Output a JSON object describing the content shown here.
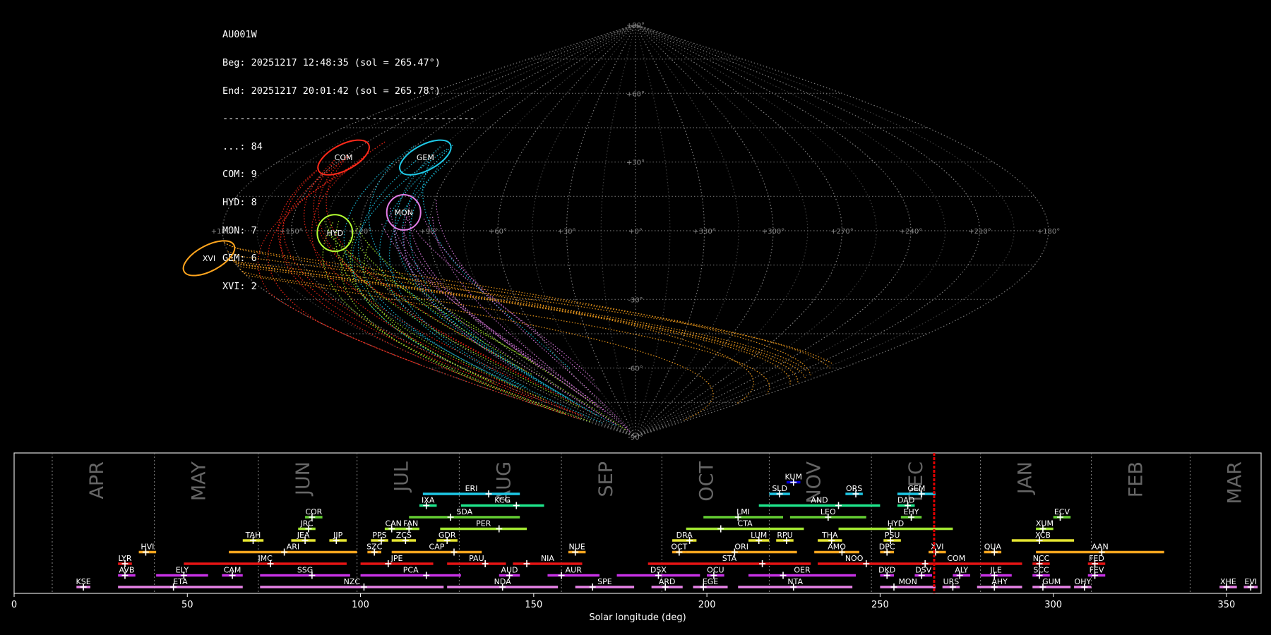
{
  "header": {
    "station": "AU001W",
    "begin": "Beg: 20251217 12:48:35 (sol = 265.47°)",
    "end": "End: 20251217 20:01:42 (sol = 265.78°)",
    "separator": "--------------------------------------------",
    "counts": [
      {
        "code": "...",
        "count": 84
      },
      {
        "code": "COM",
        "count": 9
      },
      {
        "code": "HYD",
        "count": 8
      },
      {
        "code": "MON",
        "count": 7
      },
      {
        "code": "GEM",
        "count": 6
      },
      {
        "code": "XVI",
        "count": 2
      }
    ]
  },
  "chart_data": [
    {
      "type": "scatter",
      "projection": "sinusoidal",
      "grid": true,
      "lon_tick_labels": [
        "+180°",
        "+150°",
        "+120°",
        "+90°",
        "+60°",
        "+30°",
        "+0°",
        "+330°",
        "+300°",
        "+270°",
        "+240°",
        "+210°",
        "+180°"
      ],
      "lat_tick_labels": [
        "+90°",
        "+60°",
        "+30°",
        "-30°",
        "-60°",
        "-90°"
      ],
      "radiants": [
        {
          "name": "COM",
          "lon": 150,
          "lat": 32,
          "color": "#ff2a1a"
        },
        {
          "name": "GEM",
          "lon": 108,
          "lat": 32,
          "color": "#1ec8e6"
        },
        {
          "name": "HYD",
          "lon": 131,
          "lat": -1,
          "color": "#b4ff32"
        },
        {
          "name": "MON",
          "lon": 102,
          "lat": 8,
          "color": "#e27de6"
        },
        {
          "name": "XVI",
          "lon": 190,
          "lat": -12,
          "color": "#ffa51e"
        }
      ]
    },
    {
      "type": "timeline",
      "xlabel": "Solar longitude (deg)",
      "xlim": [
        0,
        360
      ],
      "x_ticks": [
        0,
        50,
        100,
        150,
        200,
        250,
        300,
        350
      ],
      "current_solar_longitude": 265.6,
      "months": [
        {
          "label": "APR",
          "start": 11
        },
        {
          "label": "MAY",
          "start": 40.5
        },
        {
          "label": "JUN",
          "start": 70.5
        },
        {
          "label": "JUL",
          "start": 99
        },
        {
          "label": "AUG",
          "start": 128.5
        },
        {
          "label": "SEP",
          "start": 158
        },
        {
          "label": "OCT",
          "start": 187
        },
        {
          "label": "NOV",
          "start": 218
        },
        {
          "label": "DEC",
          "start": 247.5
        },
        {
          "label": "JAN",
          "start": 279
        },
        {
          "label": "FEB",
          "start": 311
        },
        {
          "label": "MAR",
          "start": 339.5
        }
      ],
      "showers": [
        {
          "code": "KUM",
          "start": 223,
          "end": 227,
          "peak": 225,
          "row": 8,
          "color": "#0000dd"
        },
        {
          "code": "ERI",
          "start": 118,
          "end": 146,
          "peak": 137,
          "row": 7,
          "color": "#1ec8e6"
        },
        {
          "code": "SLD",
          "start": 218,
          "end": 224,
          "peak": 221,
          "row": 7,
          "color": "#1ec8e6"
        },
        {
          "code": "ORS",
          "start": 240,
          "end": 245,
          "peak": 243,
          "row": 7,
          "color": "#1ec8e6"
        },
        {
          "code": "GEM",
          "start": 255,
          "end": 266,
          "peak": 262,
          "row": 7,
          "color": "#1ec8e6"
        },
        {
          "code": "IXA",
          "start": 117,
          "end": 122,
          "peak": 119,
          "row": 6,
          "color": "#1ee68c"
        },
        {
          "code": "KCG",
          "start": 129,
          "end": 153,
          "peak": 145,
          "row": 6,
          "color": "#1ee68c"
        },
        {
          "code": "AND",
          "start": 215,
          "end": 250,
          "peak": 238,
          "row": 6,
          "color": "#1ee68c"
        },
        {
          "code": "DAD",
          "start": 255,
          "end": 260,
          "peak": 258,
          "row": 6,
          "color": "#1ee68c"
        },
        {
          "code": "COR",
          "start": 84,
          "end": 89,
          "peak": 86,
          "row": 5,
          "color": "#64cd32"
        },
        {
          "code": "SDA",
          "start": 114,
          "end": 146,
          "peak": 126,
          "row": 5,
          "color": "#64cd32"
        },
        {
          "code": "LMI",
          "start": 199,
          "end": 222,
          "peak": 209,
          "row": 5,
          "color": "#64cd32"
        },
        {
          "code": "LEO",
          "start": 224,
          "end": 246,
          "peak": 235,
          "row": 5,
          "color": "#64cd32"
        },
        {
          "code": "EHY",
          "start": 256,
          "end": 262,
          "peak": 259,
          "row": 5,
          "color": "#64cd32"
        },
        {
          "code": "ECV",
          "start": 300,
          "end": 305,
          "peak": 302,
          "row": 5,
          "color": "#64cd32"
        },
        {
          "code": "JRC",
          "start": 82,
          "end": 87,
          "peak": 85,
          "row": 4,
          "color": "#a0e632"
        },
        {
          "code": "CAN",
          "start": 107,
          "end": 112,
          "peak": 109,
          "row": 4,
          "color": "#a0e632"
        },
        {
          "code": "FAN",
          "start": 112,
          "end": 117,
          "peak": 114,
          "row": 4,
          "color": "#a0e632"
        },
        {
          "code": "PER",
          "start": 123,
          "end": 148,
          "peak": 140,
          "row": 4,
          "color": "#a0e632"
        },
        {
          "code": "CTA",
          "start": 194,
          "end": 228,
          "peak": 204,
          "row": 4,
          "color": "#a0e632"
        },
        {
          "code": "HYD",
          "start": 238,
          "end": 271,
          "peak": 253,
          "row": 4,
          "color": "#a0e632"
        },
        {
          "code": "XUM",
          "start": 295,
          "end": 300,
          "peak": 297,
          "row": 4,
          "color": "#a0e632"
        },
        {
          "code": "TAH",
          "start": 66,
          "end": 72,
          "peak": 69,
          "row": 3,
          "color": "#e6e632"
        },
        {
          "code": "JEA",
          "start": 80,
          "end": 87,
          "peak": 84,
          "row": 3,
          "color": "#e6e632"
        },
        {
          "code": "JIP",
          "start": 91,
          "end": 96,
          "peak": 93,
          "row": 3,
          "color": "#e6e632"
        },
        {
          "code": "PPS",
          "start": 103,
          "end": 108,
          "peak": 106,
          "row": 3,
          "color": "#e6e632"
        },
        {
          "code": "ZCS",
          "start": 109,
          "end": 116,
          "peak": 113,
          "row": 3,
          "color": "#e6e632"
        },
        {
          "code": "GDR",
          "start": 122,
          "end": 128,
          "peak": 125,
          "row": 3,
          "color": "#e6e632"
        },
        {
          "code": "DRA",
          "start": 190,
          "end": 197,
          "peak": 195,
          "row": 3,
          "color": "#e6e632"
        },
        {
          "code": "LUM",
          "start": 212,
          "end": 218,
          "peak": 215,
          "row": 3,
          "color": "#e6e632"
        },
        {
          "code": "RPU",
          "start": 220,
          "end": 225,
          "peak": 223,
          "row": 3,
          "color": "#e6e632"
        },
        {
          "code": "THA",
          "start": 232,
          "end": 239,
          "peak": 236,
          "row": 3,
          "color": "#e6e632"
        },
        {
          "code": "PSU",
          "start": 251,
          "end": 256,
          "peak": 253,
          "row": 3,
          "color": "#e6e632"
        },
        {
          "code": "XCB",
          "start": 288,
          "end": 306,
          "peak": 296,
          "row": 3,
          "color": "#e6e632"
        },
        {
          "code": "HVI",
          "start": 36,
          "end": 41,
          "peak": 38,
          "row": 2,
          "color": "#ffa51e"
        },
        {
          "code": "ARI",
          "start": 62,
          "end": 99,
          "peak": 78,
          "row": 2,
          "color": "#ffa51e"
        },
        {
          "code": "SZC",
          "start": 102,
          "end": 106,
          "peak": 104,
          "row": 2,
          "color": "#ffa51e"
        },
        {
          "code": "CAP",
          "start": 109,
          "end": 135,
          "peak": 127,
          "row": 2,
          "color": "#ffa51e"
        },
        {
          "code": "NUE",
          "start": 160,
          "end": 165,
          "peak": 162,
          "row": 2,
          "color": "#ffa51e"
        },
        {
          "code": "OCT",
          "start": 190,
          "end": 194,
          "peak": 192,
          "row": 2,
          "color": "#ffa51e"
        },
        {
          "code": "ORI",
          "start": 194,
          "end": 226,
          "peak": 208,
          "row": 2,
          "color": "#ffa51e"
        },
        {
          "code": "AMO",
          "start": 231,
          "end": 244,
          "peak": 239,
          "row": 2,
          "color": "#ffa51e"
        },
        {
          "code": "DPC",
          "start": 250,
          "end": 254,
          "peak": 252,
          "row": 2,
          "color": "#ffa51e"
        },
        {
          "code": "XVI",
          "start": 264,
          "end": 269,
          "peak": 266,
          "row": 2,
          "color": "#ffa51e"
        },
        {
          "code": "QUA",
          "start": 280,
          "end": 285,
          "peak": 283,
          "row": 2,
          "color": "#ffa51e"
        },
        {
          "code": "AAN",
          "start": 295,
          "end": 332,
          "peak": 314,
          "row": 2,
          "color": "#ffa51e"
        },
        {
          "code": "LYR",
          "start": 30,
          "end": 34,
          "peak": 32,
          "row": 1,
          "color": "#e61414"
        },
        {
          "code": "JMC",
          "start": 49,
          "end": 96,
          "peak": 74,
          "row": 1,
          "color": "#e61414"
        },
        {
          "code": "JPE",
          "start": 100,
          "end": 121,
          "peak": 108,
          "row": 1,
          "color": "#e61414"
        },
        {
          "code": "PAU",
          "start": 125,
          "end": 142,
          "peak": 136,
          "row": 1,
          "color": "#e61414"
        },
        {
          "code": "NIA",
          "start": 144,
          "end": 164,
          "peak": 148,
          "row": 1,
          "color": "#e61414"
        },
        {
          "code": "STA",
          "start": 183,
          "end": 230,
          "peak": 216,
          "row": 1,
          "color": "#e61414"
        },
        {
          "code": "NOO",
          "start": 232,
          "end": 253,
          "peak": 246,
          "row": 1,
          "color": "#e61414"
        },
        {
          "code": "COM",
          "start": 253,
          "end": 291,
          "peak": 263,
          "row": 1,
          "color": "#e61414"
        },
        {
          "code": "NCC",
          "start": 294,
          "end": 299,
          "peak": 296,
          "row": 1,
          "color": "#e61414"
        },
        {
          "code": "FED",
          "start": 310,
          "end": 315,
          "peak": 312,
          "row": 1,
          "color": "#e61414"
        },
        {
          "code": "AVB",
          "start": 30,
          "end": 35,
          "peak": 32,
          "row": 0,
          "color": "#c832e6"
        },
        {
          "code": "ELY",
          "start": 41,
          "end": 56,
          "peak": 49,
          "row": 0,
          "color": "#c832e6"
        },
        {
          "code": "CAM",
          "start": 60,
          "end": 66,
          "peak": 63,
          "row": 0,
          "color": "#c832e6"
        },
        {
          "code": "SSG",
          "start": 71,
          "end": 97,
          "peak": 86,
          "row": 0,
          "color": "#c832e6"
        },
        {
          "code": "PCA",
          "start": 100,
          "end": 129,
          "peak": 119,
          "row": 0,
          "color": "#c832e6"
        },
        {
          "code": "AUD",
          "start": 140,
          "end": 146,
          "peak": 143,
          "row": 0,
          "color": "#c832e6"
        },
        {
          "code": "AUR",
          "start": 154,
          "end": 169,
          "peak": 158,
          "row": 0,
          "color": "#c832e6"
        },
        {
          "code": "DSX",
          "start": 174,
          "end": 198,
          "peak": 186,
          "row": 0,
          "color": "#c832e6"
        },
        {
          "code": "OCU",
          "start": 200,
          "end": 205,
          "peak": 202,
          "row": 0,
          "color": "#c832e6"
        },
        {
          "code": "OER",
          "start": 212,
          "end": 243,
          "peak": 222,
          "row": 0,
          "color": "#c832e6"
        },
        {
          "code": "DKD",
          "start": 250,
          "end": 254,
          "peak": 252,
          "row": 0,
          "color": "#c832e6"
        },
        {
          "code": "DSV",
          "start": 260,
          "end": 265,
          "peak": 262,
          "row": 0,
          "color": "#c832e6"
        },
        {
          "code": "ALY",
          "start": 271,
          "end": 276,
          "peak": 273,
          "row": 0,
          "color": "#c832e6"
        },
        {
          "code": "JLE",
          "start": 279,
          "end": 288,
          "peak": 283,
          "row": 0,
          "color": "#c832e6"
        },
        {
          "code": "SCC",
          "start": 294,
          "end": 299,
          "peak": 296,
          "row": 0,
          "color": "#c832e6"
        },
        {
          "code": "FEV",
          "start": 310,
          "end": 315,
          "peak": 312,
          "row": 0,
          "color": "#c832e6"
        },
        {
          "code": "KSE",
          "start": 18,
          "end": 22,
          "peak": 20,
          "row": -1,
          "color": "#e682e6"
        },
        {
          "code": "ETA",
          "start": 30,
          "end": 66,
          "peak": 46,
          "row": -1,
          "color": "#e682e6"
        },
        {
          "code": "NZC",
          "start": 71,
          "end": 124,
          "peak": 101,
          "row": -1,
          "color": "#e682e6"
        },
        {
          "code": "NDA",
          "start": 125,
          "end": 157,
          "peak": 141,
          "row": -1,
          "color": "#e682e6"
        },
        {
          "code": "SPE",
          "start": 162,
          "end": 179,
          "peak": 167,
          "row": -1,
          "color": "#e682e6"
        },
        {
          "code": "ARD",
          "start": 184,
          "end": 193,
          "peak": 188,
          "row": -1,
          "color": "#e682e6"
        },
        {
          "code": "EGE",
          "start": 196,
          "end": 206,
          "peak": 199,
          "row": -1,
          "color": "#e682e6"
        },
        {
          "code": "NTA",
          "start": 209,
          "end": 242,
          "peak": 225,
          "row": -1,
          "color": "#e682e6"
        },
        {
          "code": "MON",
          "start": 250,
          "end": 266,
          "peak": 254,
          "row": -1,
          "color": "#e682e6"
        },
        {
          "code": "URS",
          "start": 268,
          "end": 273,
          "peak": 271,
          "row": -1,
          "color": "#e682e6"
        },
        {
          "code": "AHY",
          "start": 278,
          "end": 291,
          "peak": 283,
          "row": -1,
          "color": "#e682e6"
        },
        {
          "code": "GUM",
          "start": 294,
          "end": 305,
          "peak": 297,
          "row": -1,
          "color": "#e682e6"
        },
        {
          "code": "OHY",
          "start": 306,
          "end": 311,
          "peak": 309,
          "row": -1,
          "color": "#e682e6"
        },
        {
          "code": "XHE",
          "start": 348,
          "end": 353,
          "peak": 350,
          "row": -1,
          "color": "#e682e6"
        },
        {
          "code": "EVI",
          "start": 355,
          "end": 359,
          "peak": 357,
          "row": -1,
          "color": "#e682e6"
        }
      ]
    }
  ]
}
